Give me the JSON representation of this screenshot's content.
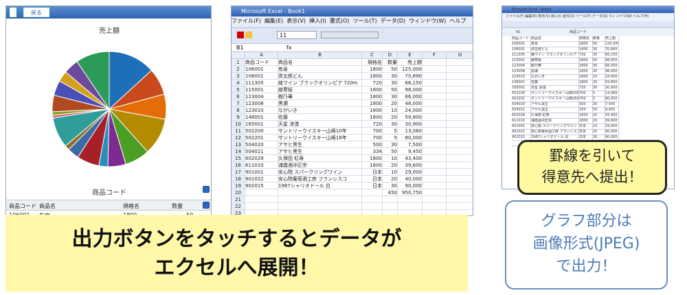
{
  "app": {
    "top_button": "戻る",
    "chart_title": "売上額",
    "axis_label": "商品コード",
    "table_headers": [
      "商品コード",
      "商品名",
      "規格名",
      "数量"
    ],
    "first_row": [
      "106001",
      "有泉",
      "1800",
      "50"
    ]
  },
  "excel": {
    "title": "Microsoft Excel - Book1",
    "menu": [
      "ファイル(F)",
      "編集(E)",
      "表示(V)",
      "挿入(I)",
      "書式(O)",
      "ツール(T)",
      "データ(D)",
      "ウィンドウ(W)",
      "ヘルプ(H)"
    ],
    "font_size": "11",
    "name_box": "B1",
    "columns": [
      "A",
      "B",
      "C",
      "D",
      "E",
      "F",
      "G"
    ],
    "headers": [
      "商品コード",
      "商品名",
      "規格名",
      "数量",
      "売上額"
    ],
    "rows": [
      [
        "106001",
        "有泉",
        "1800",
        "50",
        "125,000"
      ],
      [
        "108001",
        "弥五郎どん",
        "1800",
        "30",
        "70,890"
      ],
      [
        "111305",
        "綾ワイン ブラックオリンピア 720m",
        "720",
        "30",
        "66,150"
      ],
      [
        "115001",
        "綾寒桜",
        "1800",
        "50",
        "98,000"
      ],
      [
        "123004",
        "樹乃華",
        "1800",
        "30",
        "66,000"
      ],
      [
        "123008",
        "黒瀬",
        "1800",
        "20",
        "48,000"
      ],
      [
        "123010",
        "ながいき",
        "1800",
        "10",
        "24,000"
      ],
      [
        "148001",
        "佐藤",
        "1800",
        "20",
        "59,800"
      ],
      [
        "165001",
        "天星 涼湧",
        "720",
        "30",
        "30,900"
      ],
      [
        "502200",
        "サントリーウイスキー山崎10年",
        "700",
        "5",
        "13,060"
      ],
      [
        "502201",
        "サントリーウイスキー山崎18年",
        "700",
        "5",
        "80,000"
      ],
      [
        "504020",
        "アサヒ黒生",
        "500",
        "30",
        "7,500"
      ],
      [
        "504021",
        "アサヒ黒生",
        "334",
        "50",
        "9,450"
      ],
      [
        "602028",
        "久保田 紅寿",
        "1800",
        "10",
        "43,400"
      ],
      [
        "611010",
        "浦霞酒沖正宗",
        "1800",
        "20",
        "39,600"
      ],
      [
        "901001",
        "安心院 スパークリングワイン",
        "日本",
        "10",
        "29,000"
      ],
      [
        "901022",
        "安心院葡萄酒工房 フランシスコ",
        "日本",
        "20",
        "40,000"
      ],
      [
        "902015",
        "1987シャリオドール 白",
        "日本",
        "30",
        "90,000"
      ]
    ],
    "total_qty": "450",
    "total_sales": "950,750"
  },
  "mini": {
    "title": "Microsoft Excel - Book1",
    "menu": "ファイル(F) 編集(E) 表示(V) 挿入(I) 書式(O) ツール(T) データ(D) ウィンドウ(W) ヘルプ(H)",
    "name_box": "A1",
    "cell": "商品コード"
  },
  "callouts": {
    "boxed_line1": "罫線を引いて",
    "boxed_line2": "得意先へ提出！",
    "graph_line1": "グラフ部分は",
    "graph_line2": "画像形式(JPEG)",
    "graph_line3": "で出力！"
  },
  "banner": {
    "line1": "出力ボタンをタッチするとデータが",
    "line2": "エクセルへ展開！"
  },
  "chart_data": {
    "type": "pie",
    "title": "売上額",
    "xlabel": "商品コード",
    "categories": [
      "106001",
      "108001",
      "111305",
      "115001",
      "123004",
      "123008",
      "123010",
      "148001",
      "165001",
      "502200",
      "502201",
      "504020",
      "504021",
      "602028",
      "611010",
      "901001",
      "901022",
      "902015"
    ],
    "values": [
      125000,
      70890,
      66150,
      98000,
      66000,
      48000,
      24000,
      59800,
      30900,
      13060,
      80000,
      7500,
      9450,
      43400,
      39600,
      29000,
      40000,
      90000
    ],
    "colors": [
      "#1f6fb8",
      "#c94a1d",
      "#e46d0a",
      "#b38a00",
      "#4c9f26",
      "#7d2b8f",
      "#2a8fb8",
      "#a72027",
      "#3d6aa5",
      "#8c6f2b",
      "#2f9e9a",
      "#d65f84",
      "#8aa226",
      "#b14a22",
      "#4a4fb8",
      "#d4a01b",
      "#6e4a9c",
      "#2c9b5a"
    ]
  }
}
